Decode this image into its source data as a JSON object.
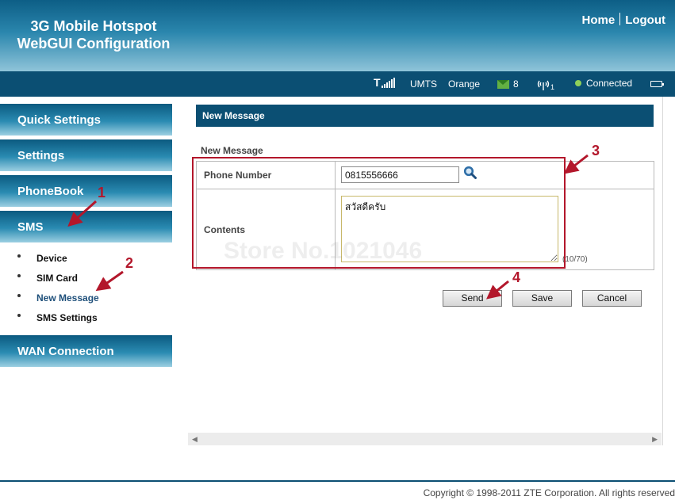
{
  "header": {
    "brand_line1": "3G Mobile Hotspot",
    "brand_line2": "WebGUI Configuration",
    "home_link": "Home",
    "logout_link": "Logout"
  },
  "status": {
    "network_type": "UMTS",
    "operator": "Orange",
    "sms_count": "8",
    "wifi_clients": "1",
    "connection": "Connected",
    "icons": [
      "signal-strength-icon",
      "sms-envelope-icon",
      "wifi-antenna-icon",
      "connection-status-icon",
      "battery-icon"
    ]
  },
  "sidebar": {
    "items": [
      {
        "label": "Quick Settings"
      },
      {
        "label": "Settings"
      },
      {
        "label": "PhoneBook"
      },
      {
        "label": "SMS"
      },
      {
        "label": "WAN Connection"
      }
    ],
    "sms_submenu": [
      {
        "label": "Device"
      },
      {
        "label": "SIM Card"
      },
      {
        "label": "New Message",
        "active": true
      },
      {
        "label": "SMS Settings"
      }
    ]
  },
  "main": {
    "title": "New Message",
    "section_label": "New Message",
    "phone_label": "Phone Number",
    "phone_value": "0815556666",
    "contents_label": "Contents",
    "contents_value": "สวัสดีครับ",
    "counter": "(10/70)",
    "buttons": {
      "send": "Send",
      "save": "Save",
      "cancel": "Cancel"
    }
  },
  "footer": {
    "copyright": "Copyright © 1998-2011 ZTE Corporation. All rights reserved"
  },
  "annotations": {
    "step1": "1",
    "step2": "2",
    "step3": "3",
    "step4": "4",
    "color": "#b3172b"
  },
  "watermark": "Store No.1021046",
  "colors": {
    "header_dark": "#0b4f73",
    "active_submenu": "#1e4f7a"
  }
}
